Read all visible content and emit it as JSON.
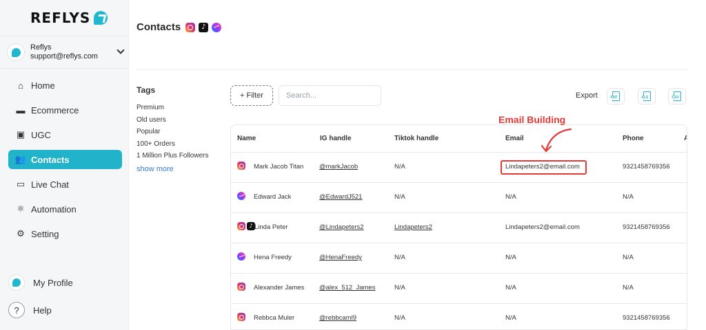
{
  "brand": {
    "name": "REFLYS"
  },
  "account": {
    "name": "Reflys",
    "email": "support@reflys.com"
  },
  "nav": [
    {
      "label": "Home",
      "icon": "home-icon",
      "active": false
    },
    {
      "label": "Ecommerce",
      "icon": "store-icon",
      "active": false
    },
    {
      "label": "UGC",
      "icon": "image-icon",
      "active": false
    },
    {
      "label": "Contacts",
      "icon": "users-icon",
      "active": true
    },
    {
      "label": "Live Chat",
      "icon": "chat-icon",
      "active": false
    },
    {
      "label": "Automation",
      "icon": "atom-icon",
      "active": false
    },
    {
      "label": "Setting",
      "icon": "gear-icon",
      "active": false
    }
  ],
  "bottom_nav": {
    "profile": "My Profile",
    "help": "Help"
  },
  "page": {
    "title": "Contacts"
  },
  "tags": {
    "title": "Tags",
    "items": [
      "Premium",
      "Old users",
      "Popular",
      "100+ Orders",
      "1 Million Plus Followers"
    ],
    "show_more": "show more"
  },
  "toolbar": {
    "filter_label": "+ Filter",
    "search_placeholder": "Search...",
    "export_label": "Export"
  },
  "export_formats": [
    "PDF",
    "XLS",
    "CSV"
  ],
  "table": {
    "columns": [
      "Name",
      "IG handle",
      "Tiktok handle",
      "Email",
      "Phone",
      "A"
    ],
    "rows": [
      {
        "icons": [
          "ig"
        ],
        "name": "Mark Jacob Titan",
        "ig": "@markJacob",
        "tiktok": "N/A",
        "email": "Lindapeters2@email.com",
        "phone": "9321458769356",
        "tiktok_link": false
      },
      {
        "icons": [
          "ms"
        ],
        "name": "Edward Jack",
        "ig": "@EdwardJ521",
        "tiktok": "N/A",
        "email": "N/A",
        "phone": "N/A",
        "tiktok_link": false
      },
      {
        "icons": [
          "ig",
          "tt"
        ],
        "name": "Linda Peter",
        "ig": "@Lindapeters2",
        "tiktok": "Lindapeters2",
        "email": "Lindapeters2@email.com",
        "phone": "9321458769356",
        "tiktok_link": true
      },
      {
        "icons": [
          "ms"
        ],
        "name": "Hena Freedy",
        "ig": "@HenaFreedy",
        "tiktok": "N/A",
        "email": "N/A",
        "phone": "N/A",
        "tiktok_link": false
      },
      {
        "icons": [
          "ig"
        ],
        "name": "Alexander James",
        "ig": "@alex_512_James",
        "tiktok": "N/A",
        "email": "N/A",
        "phone": "N/A",
        "tiktok_link": false
      },
      {
        "icons": [
          "ig"
        ],
        "name": "Rebbca Muler",
        "ig": "@rebbcaml9",
        "tiktok": "N/A",
        "email": "N/A",
        "phone": "9321458769356",
        "tiktok_link": false
      }
    ]
  },
  "annotation": {
    "label": "Email Building",
    "color": "#e53935"
  },
  "colors": {
    "accent": "#21b3c9"
  }
}
